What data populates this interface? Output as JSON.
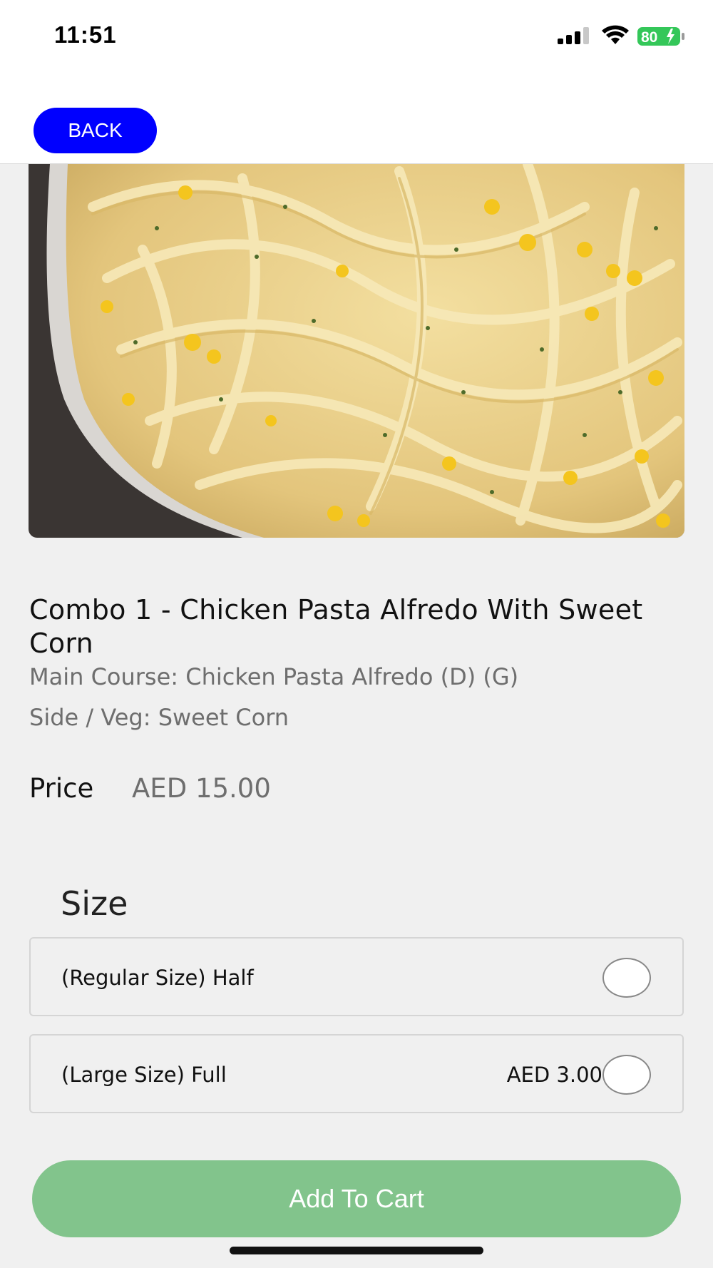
{
  "status_bar": {
    "time": "11:51",
    "battery": "80",
    "icons": [
      "signal-icon",
      "wifi-icon",
      "battery-charging-icon"
    ],
    "battery_color": "#34c759"
  },
  "header": {
    "back_label": "BACK",
    "accent": "#0000ff"
  },
  "product": {
    "image_desc": "fettuccine-with-sweet-corn-photo",
    "title": "Combo 1 - Chicken Pasta Alfredo With Sweet Corn",
    "description_lines": [
      "Main Course: Chicken Pasta Alfredo (D) (G)",
      "Side / Veg: Sweet Corn"
    ],
    "price_label": "Price",
    "price_value": "AED 15.00"
  },
  "size": {
    "heading": "Size",
    "options": [
      {
        "label": "(Regular Size) Half",
        "price": "",
        "selected": false
      },
      {
        "label": "(Large Size) Full",
        "price": "AED 3.00",
        "selected": false
      }
    ]
  },
  "cart": {
    "button_label": "Add To Cart",
    "button_color": "#82c48c"
  }
}
